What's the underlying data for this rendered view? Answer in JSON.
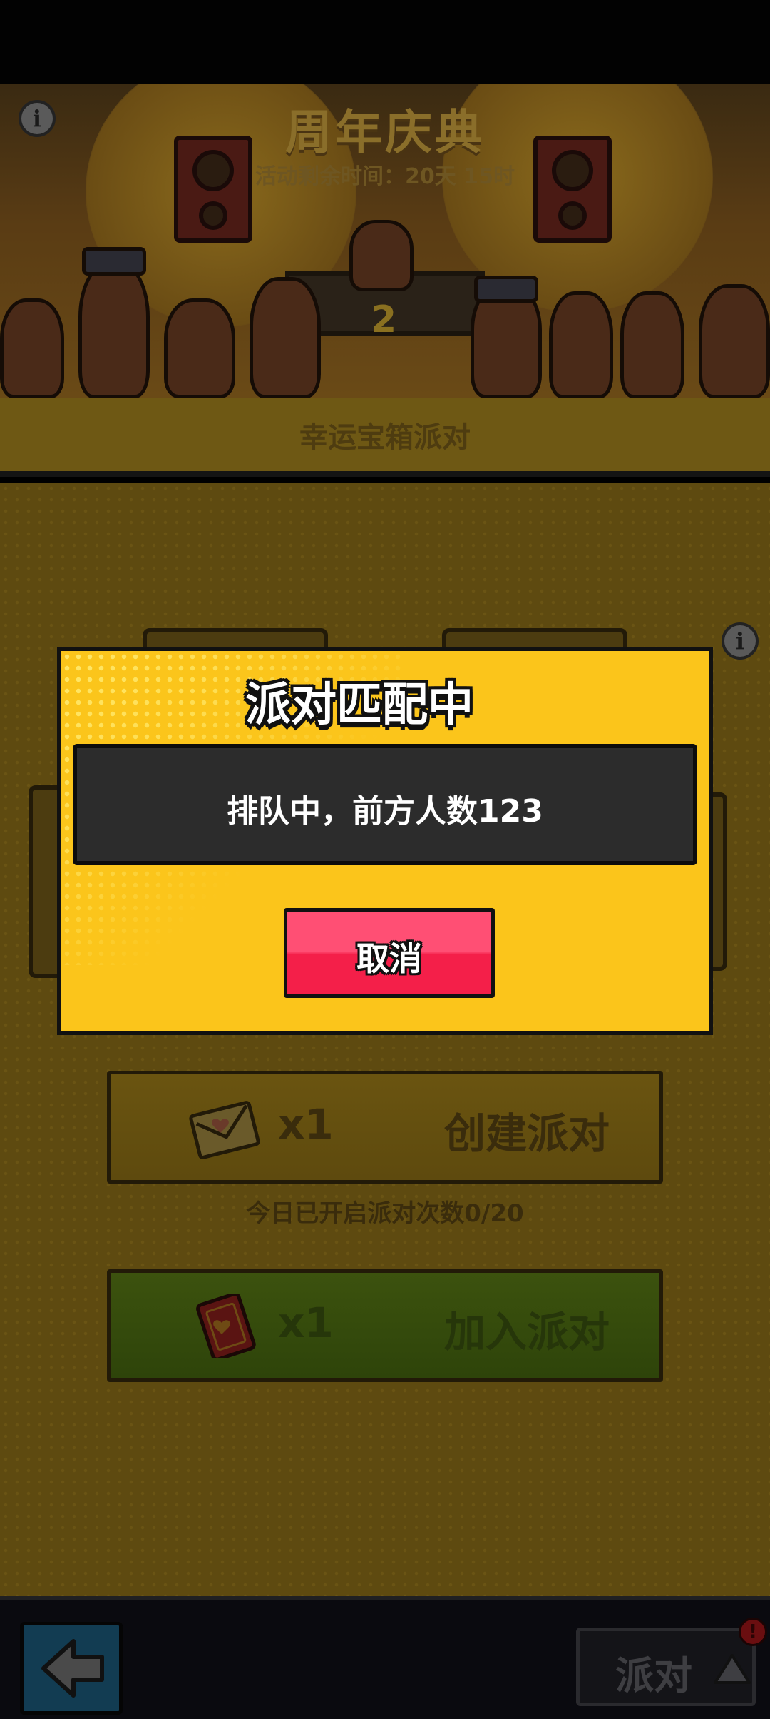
{
  "banner": {
    "title": "周年庆典",
    "subtitle": "活动剩余时间：20天 15时",
    "stage_number": "2"
  },
  "section": {
    "title": "幸运宝箱派对"
  },
  "create_party": {
    "multiplier": "x1",
    "label": "创建派对",
    "icon": "envelope-icon"
  },
  "daily_count": "今日已开启派对次数0/20",
  "join_party": {
    "multiplier": "x1",
    "label": "加入派对",
    "icon": "red-card-icon"
  },
  "bottom_bar": {
    "party_label": "派对",
    "badge": "!"
  },
  "modal": {
    "title": "派对匹配中",
    "queue_text": "排队中，前方人数123",
    "cancel_label": "取消"
  },
  "info_glyph": "i",
  "colors": {
    "modal_background": "#fbc51b",
    "cancel_button": "#f41f49",
    "queue_box": "#2c2c2c"
  }
}
